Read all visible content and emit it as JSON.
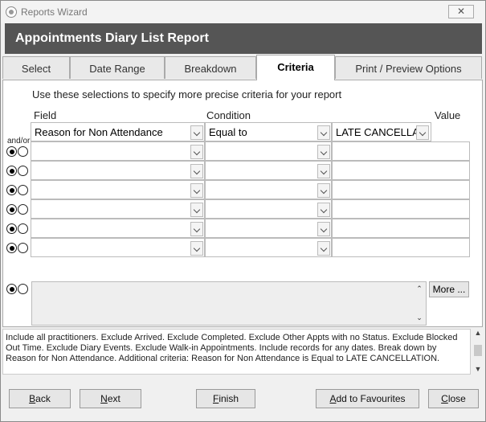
{
  "window": {
    "title": "Reports Wizard",
    "close_glyph": "✕",
    "icon": "app-icon"
  },
  "header": {
    "title": "Appointments Diary List Report"
  },
  "tabs": [
    {
      "label": "Select",
      "active": false
    },
    {
      "label": "Date Range",
      "active": false
    },
    {
      "label": "Breakdown",
      "active": false
    },
    {
      "label": "Criteria",
      "active": true
    },
    {
      "label": "Print / Preview Options",
      "active": false
    }
  ],
  "criteria": {
    "intro": "Use these selections to specify more precise criteria for your report",
    "columns": {
      "field": "Field",
      "condition": "Condition",
      "value": "Value"
    },
    "andor_label": "and/or",
    "rows": [
      {
        "field": "Reason for Non Attendance",
        "condition": "Equal to",
        "value": "LATE CANCELLATI"
      },
      {
        "field": "",
        "condition": "",
        "value": ""
      },
      {
        "field": "",
        "condition": "",
        "value": ""
      },
      {
        "field": "",
        "condition": "",
        "value": ""
      },
      {
        "field": "",
        "condition": "",
        "value": ""
      },
      {
        "field": "",
        "condition": "",
        "value": ""
      },
      {
        "field": "",
        "condition": "",
        "value": ""
      },
      {
        "field": "",
        "condition": "",
        "value": ""
      }
    ],
    "more_button": "More ..."
  },
  "description": "Include all practitioners. Exclude Arrived. Exclude Completed. Exclude Other Appts with no Status. Exclude Blocked Out Time. Exclude Diary Events. Exclude Walk-in Appointments. Include records for any dates. Break down by Reason for Non Attendance. Additional criteria: Reason for Non Attendance is Equal to LATE CANCELLATION.",
  "buttons": {
    "back": {
      "mnemonic": "B",
      "rest": "ack"
    },
    "next": {
      "mnemonic": "N",
      "rest": "ext"
    },
    "finish": {
      "mnemonic": "F",
      "rest": "inish"
    },
    "favourites": {
      "mnemonic": "A",
      "rest": "dd to Favourites"
    },
    "close": {
      "mnemonic": "C",
      "rest": "lose"
    }
  },
  "colors": {
    "header_bg": "#555555",
    "header_text": "#ffffff",
    "panel_bg": "#ffffff"
  }
}
